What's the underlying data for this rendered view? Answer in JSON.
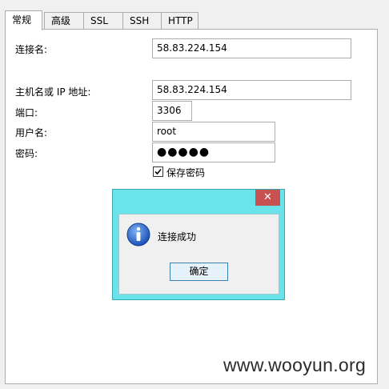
{
  "tabs": [
    {
      "label": "常规",
      "active": true
    },
    {
      "label": "高级",
      "active": false
    },
    {
      "label": "SSL",
      "active": false
    },
    {
      "label": "SSH",
      "active": false
    },
    {
      "label": "HTTP",
      "active": false
    }
  ],
  "form": {
    "connection_name": {
      "label": "连接名:",
      "value": "58.83.224.154"
    },
    "host": {
      "label": "主机名或 IP 地址:",
      "value": "58.83.224.154"
    },
    "port": {
      "label": "端口:",
      "value": "3306"
    },
    "username": {
      "label": "用户名:",
      "value": "root"
    },
    "password": {
      "label": "密码:",
      "value": "●●●●●"
    },
    "save_password": {
      "label": "保存密码",
      "checked": true
    }
  },
  "dialog": {
    "close_glyph": "✕",
    "message": "连接成功",
    "ok_label": "确定",
    "icon": "info-icon",
    "frame_color": "#6be3ea"
  },
  "watermark": "www.wooyun.org"
}
